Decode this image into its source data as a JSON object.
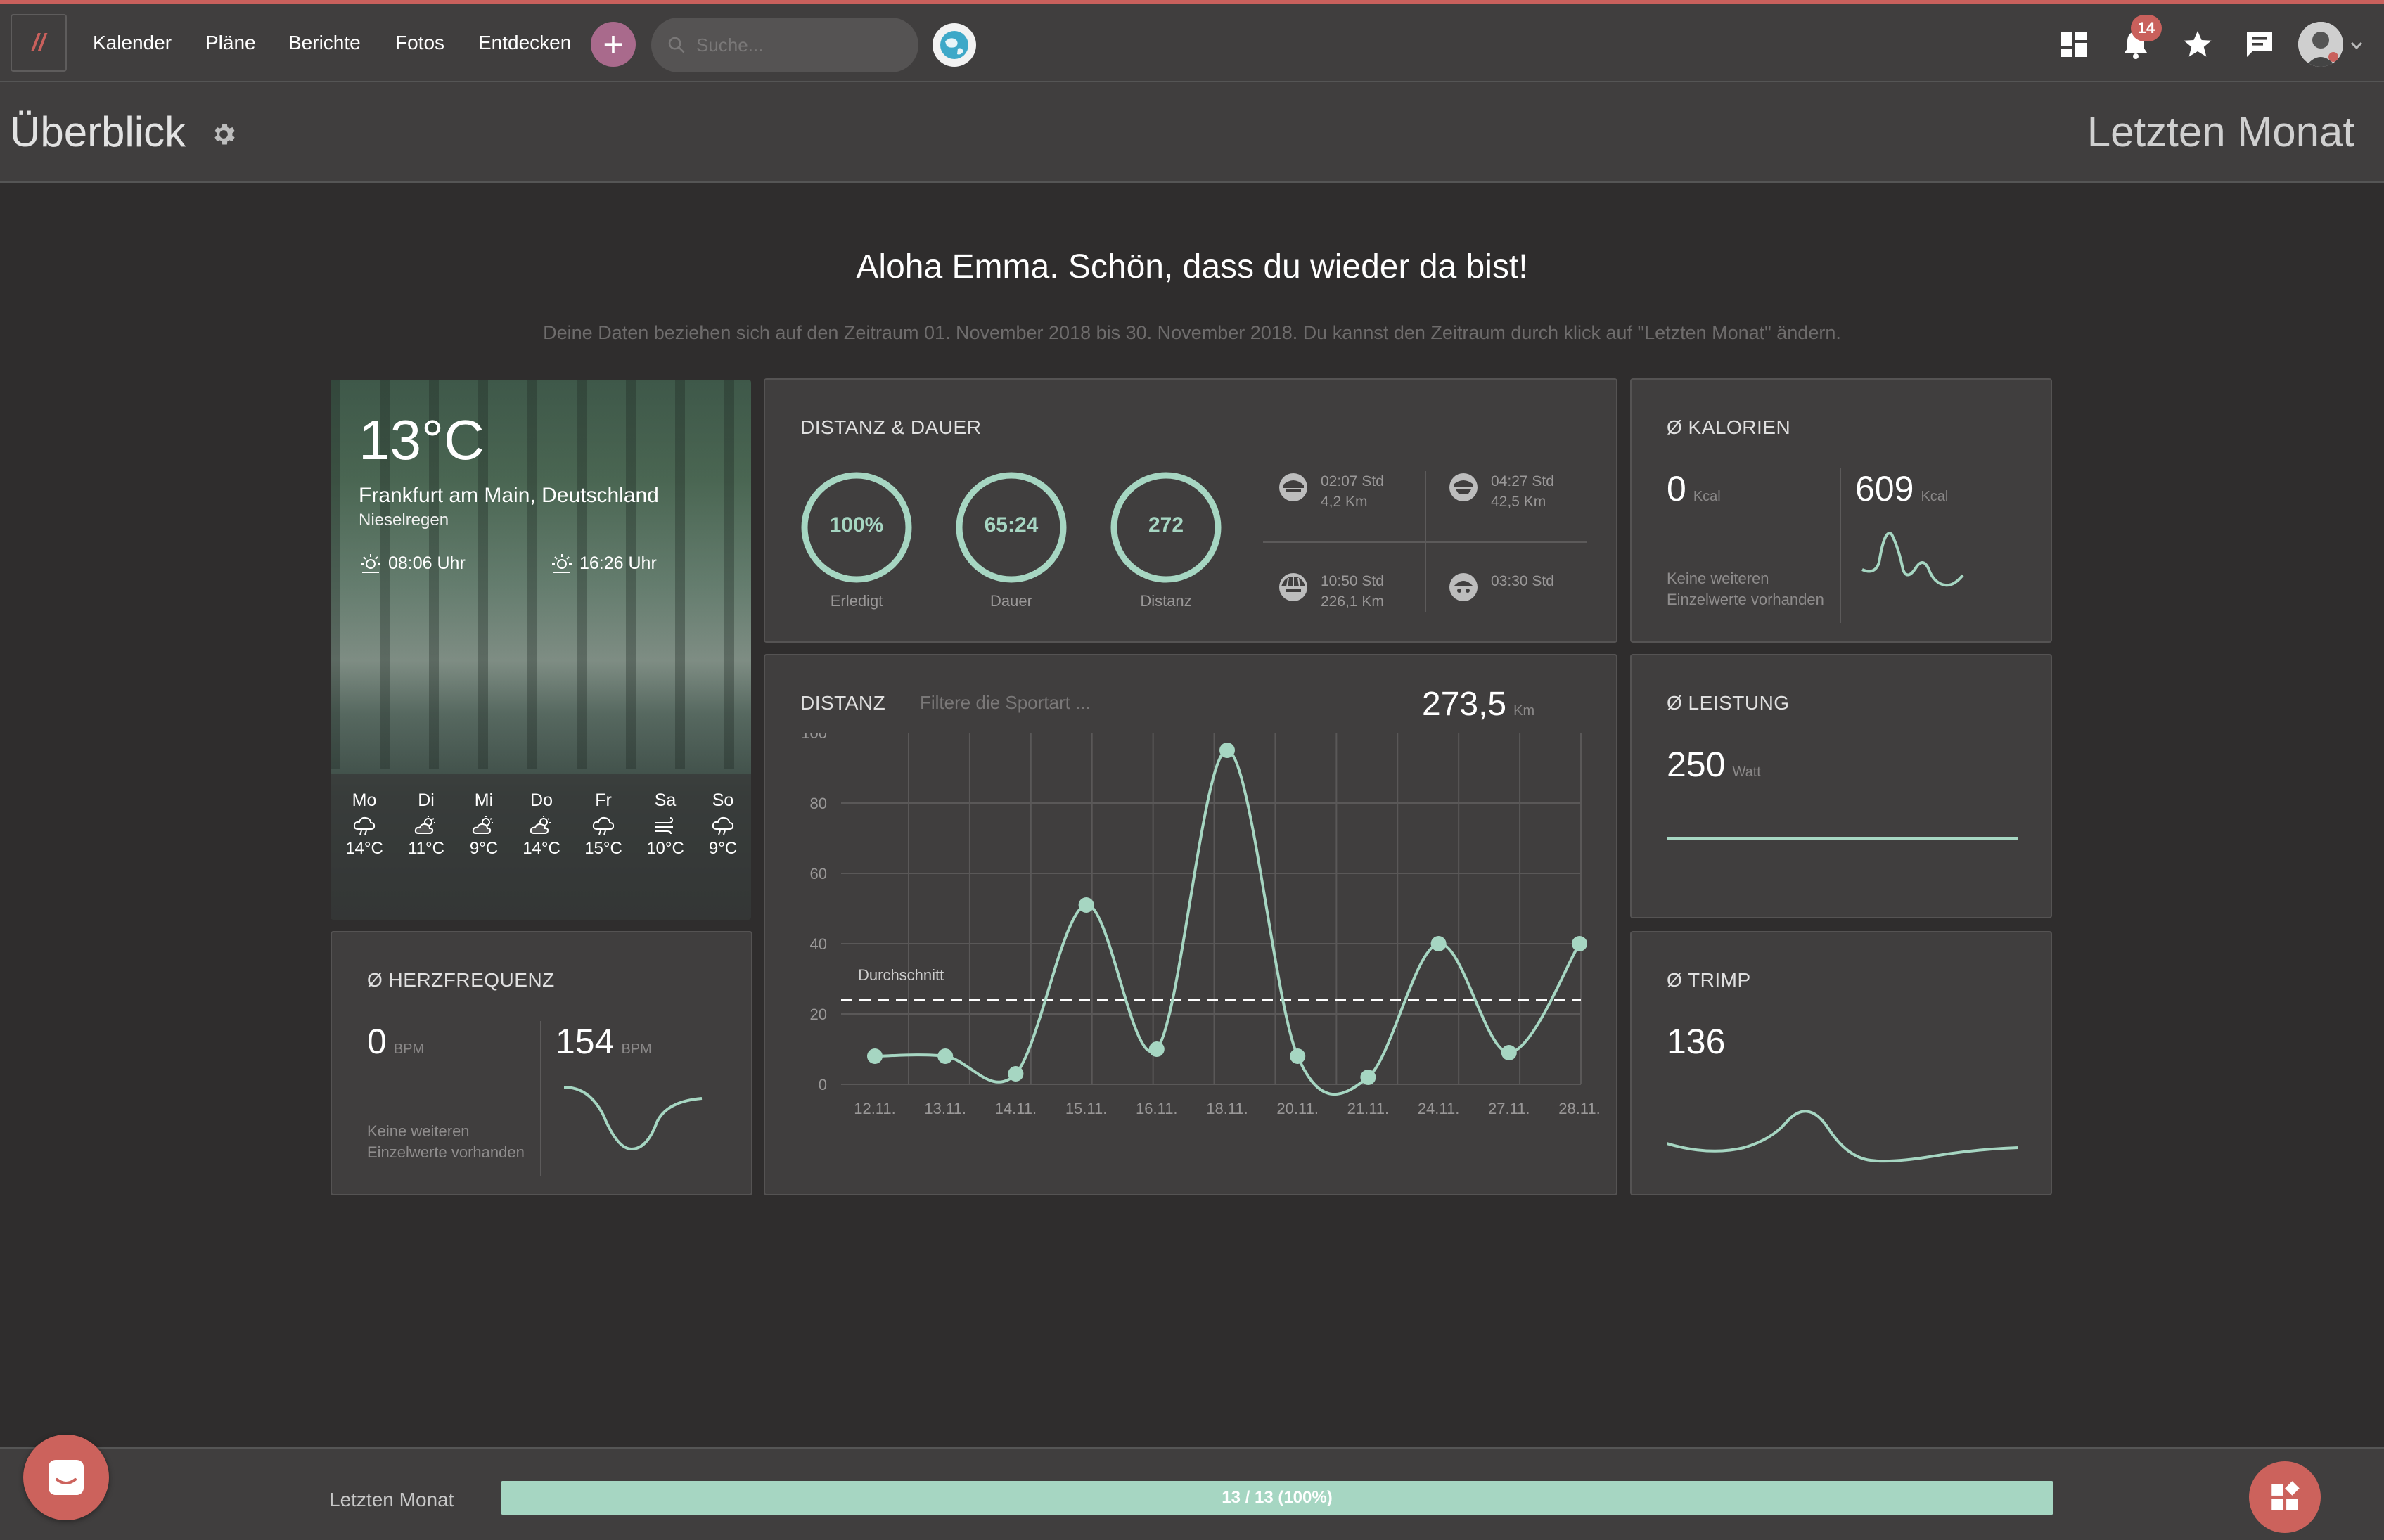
{
  "nav": {
    "links": [
      "Kalender",
      "Pläne",
      "Berichte",
      "Fotos",
      "Entdecken"
    ],
    "search_placeholder": "Suche...",
    "notification_count": "14"
  },
  "header": {
    "title": "Überblick",
    "period": "Letzten Monat"
  },
  "greeting": {
    "title": "Aloha Emma. Schön, dass du wieder da bist!",
    "subtitle": "Deine Daten beziehen sich auf den Zeitraum 01. November 2018 bis 30. November 2018. Du kannst den Zeitraum durch klick auf \"Letzten Monat\" ändern."
  },
  "weather": {
    "temperature": "13°C",
    "city": "Frankfurt am Main, Deutschland",
    "condition": "Nieselregen",
    "sunrise": "08:06 Uhr",
    "sunset": "16:26 Uhr",
    "forecast": [
      {
        "day": "Mo",
        "icon": "rain-cloud-icon",
        "temp": "14°C"
      },
      {
        "day": "Di",
        "icon": "partly-cloudy-icon",
        "temp": "11°C"
      },
      {
        "day": "Mi",
        "icon": "partly-cloudy-icon",
        "temp": "9°C"
      },
      {
        "day": "Do",
        "icon": "partly-cloudy-icon",
        "temp": "14°C"
      },
      {
        "day": "Fr",
        "icon": "rain-cloud-icon",
        "temp": "15°C"
      },
      {
        "day": "Sa",
        "icon": "wind-icon",
        "temp": "10°C"
      },
      {
        "day": "So",
        "icon": "rain-cloud-icon",
        "temp": "9°C"
      }
    ]
  },
  "distance_duration": {
    "title": "DISTANZ & DAUER",
    "rings": [
      {
        "value": "100%",
        "label": "Erledigt"
      },
      {
        "value": "65:24",
        "label": "Dauer"
      },
      {
        "value": "272",
        "label": "Distanz"
      }
    ],
    "sports": [
      {
        "icon": "cycling-helmet-icon",
        "time": "02:07 Std",
        "dist": "4,2 Km"
      },
      {
        "icon": "running-icon",
        "time": "04:27 Std",
        "dist": "42,5 Km"
      },
      {
        "icon": "bike-helmet-icon",
        "time": "10:50 Std",
        "dist": "226,1 Km"
      },
      {
        "icon": "swim-icon",
        "time": "03:30 Std",
        "dist": ""
      }
    ]
  },
  "calories": {
    "title": "Ø KALORIEN",
    "left_value": "0",
    "left_unit": "Kcal",
    "right_value": "609",
    "right_unit": "Kcal",
    "note_line1": "Keine weiteren",
    "note_line2": "Einzelwerte vorhanden"
  },
  "distance_chart": {
    "title": "DISTANZ",
    "filter_placeholder": "Filtere die Sportart ...",
    "total": "273,5",
    "total_unit": "Km",
    "average_label": "Durchschnitt"
  },
  "power": {
    "title": "Ø LEISTUNG",
    "value": "250",
    "unit": "Watt"
  },
  "heart_rate": {
    "title": "Ø HERZFREQUENZ",
    "left_value": "0",
    "left_unit": "BPM",
    "right_value": "154",
    "right_unit": "BPM",
    "note_line1": "Keine weiteren",
    "note_line2": "Einzelwerte vorhanden"
  },
  "trimp": {
    "title": "Ø TRIMP",
    "value": "136"
  },
  "bottom": {
    "period": "Letzten Monat",
    "progress_text": "13 / 13 (100%)",
    "progress_fraction": 1.0
  },
  "colors": {
    "accent": "#a6d6c2",
    "brand": "#c9605c",
    "card_bg": "#403e3e",
    "page_bg": "#2f2d2d"
  },
  "chart_data": {
    "type": "line",
    "categories": [
      "12.11.",
      "13.11.",
      "14.11.",
      "15.11.",
      "16.11.",
      "18.11.",
      "20.11.",
      "21.11.",
      "24.11.",
      "27.11.",
      "28.11."
    ],
    "values": [
      8,
      8,
      3,
      51,
      10,
      95,
      8,
      2,
      40,
      9,
      40
    ],
    "average": 24,
    "ylim": [
      0,
      100
    ],
    "yticks": [
      0,
      20,
      40,
      60,
      80,
      100
    ],
    "grid": true
  }
}
